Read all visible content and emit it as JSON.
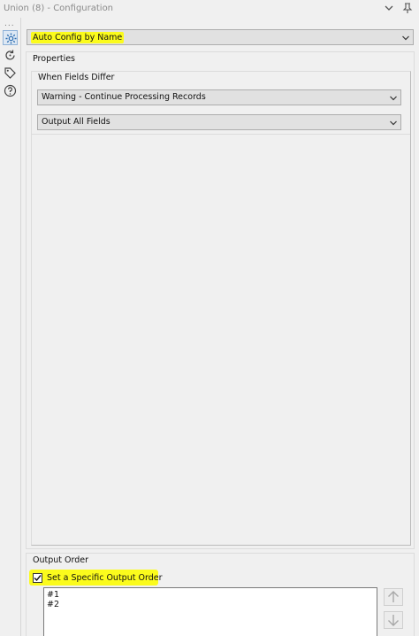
{
  "window": {
    "title": "Union (8) - Configuration"
  },
  "sidebar": {
    "overflow": "...",
    "icons": [
      "gear-icon",
      "refresh-icon",
      "tag-icon",
      "help-icon"
    ]
  },
  "main": {
    "config_mode": {
      "selected": "Auto Config by Name",
      "highlighted": true
    },
    "properties": {
      "label": "Properties",
      "when_fields_differ": {
        "label": "When Fields Differ",
        "action": "Warning - Continue Processing Records",
        "output_fields": "Output All Fields"
      }
    },
    "output_order": {
      "label": "Output Order",
      "checkbox_label": "Set a Specific Output Order",
      "checked": true,
      "items": [
        "#1",
        "#2"
      ]
    }
  },
  "colors": {
    "highlight": "#fbfb1c",
    "control_bg": "#e1e1e1",
    "panel_bg": "#f0f0f0"
  }
}
